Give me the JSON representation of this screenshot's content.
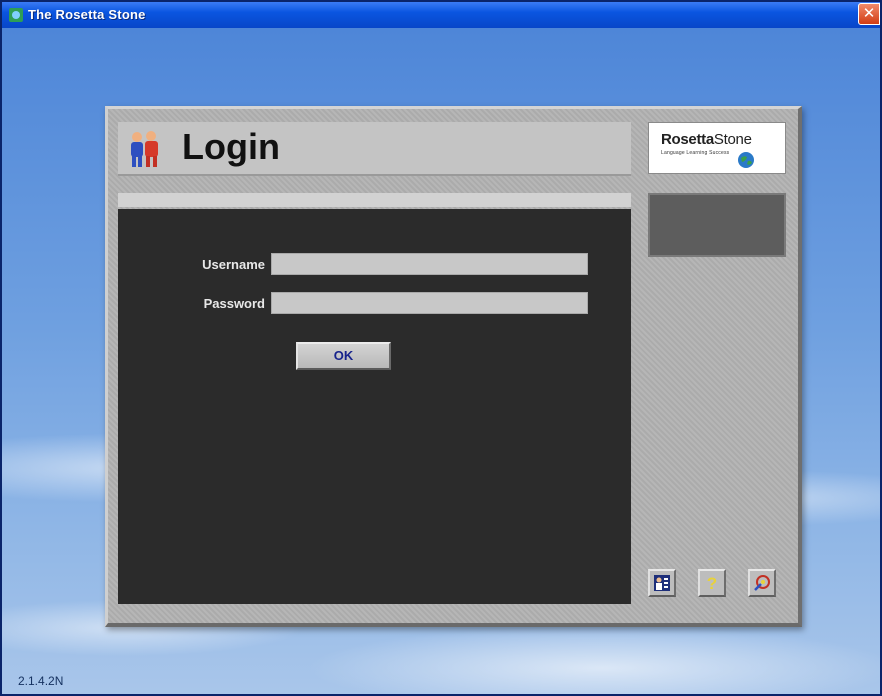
{
  "window": {
    "title": "The Rosetta Stone",
    "close_icon": "close-icon"
  },
  "version": "2.1.4.2N",
  "login": {
    "title": "Login",
    "icon": "users-icon"
  },
  "logo": {
    "brand_bold": "Rosetta",
    "brand_light": "Stone",
    "tagline": "Language Learning Success"
  },
  "form": {
    "username_label": "Username",
    "username_value": "",
    "password_label": "Password",
    "password_value": "",
    "ok_label": "OK"
  },
  "tools": {
    "users_button_icon": "user-settings-icon",
    "help_button_icon": "help-icon",
    "exit_button_icon": "exit-icon"
  },
  "colors": {
    "titlebar": "#0a55e0",
    "panel": "#b2b2b2",
    "main_area": "#2b2b2b",
    "ok_text": "#17238c"
  }
}
